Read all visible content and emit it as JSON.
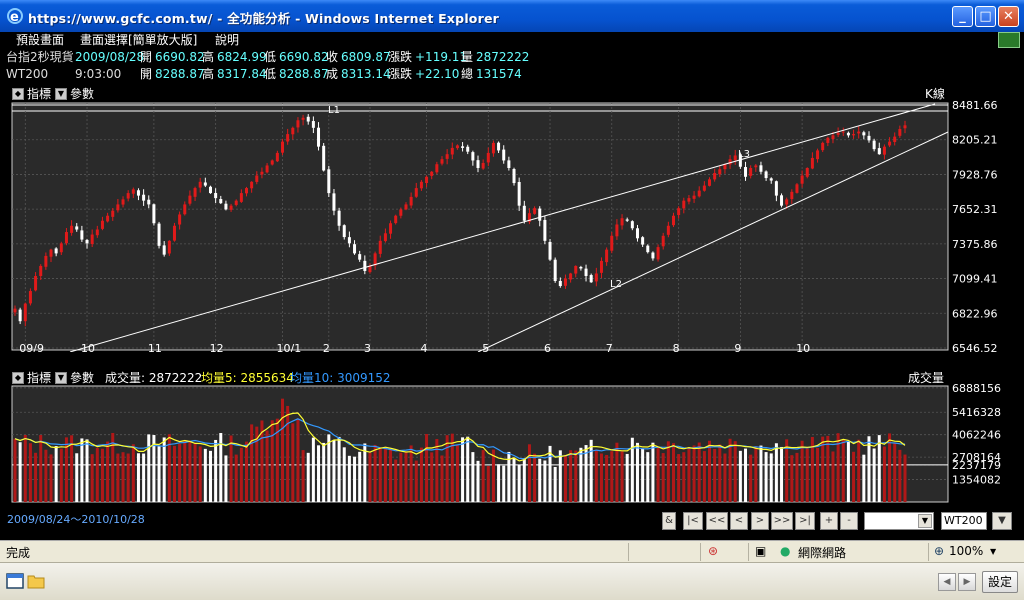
{
  "window": {
    "title": "https://www.gcfc.com.tw/ - 全功能分析 - Windows Internet Explorer",
    "min_label": "_",
    "max_label": "□",
    "close_label": "✕"
  },
  "menu": {
    "items": [
      "預設畫面",
      "畫面選擇[簡單放大版]",
      "說明"
    ]
  },
  "quote_rows": [
    {
      "name": "台指2秒現貨",
      "date": "2009/08/28",
      "open_label": "開",
      "open": "6690.82",
      "high_label": "高",
      "high": "6824.99",
      "low_label": "低",
      "low": "6690.82",
      "close_label": "收",
      "close": "6809.87",
      "chg_label": "漲跌",
      "chg": "+119.11",
      "vol_label": "量",
      "vol": "2872222"
    },
    {
      "name": "WT200",
      "date": "9:03:00",
      "open_label": "開",
      "open": "8288.87",
      "high_label": "高",
      "high": "8317.84",
      "low_label": "低",
      "low": "8288.87",
      "close_label": "成",
      "close": "8313.14",
      "chg_label": "漲跌",
      "chg": "+22.10",
      "vol_label": "總",
      "vol": "131574"
    }
  ],
  "price_panel": {
    "indicator_label": "指標",
    "param_label": "參數",
    "type_label": "K線",
    "trend_labels": [
      "L1",
      "L2",
      "L3"
    ]
  },
  "volume_panel": {
    "indicator_label": "指標",
    "param_label": "參數",
    "vol_text": "成交量: 2872222",
    "ma5_text": "均量5: 2855634",
    "ma10_text": "均量10: 3009152",
    "type_label": "成交量"
  },
  "navbar": {
    "daterange": "2009/08/24～2010/10/28",
    "buttons": [
      "&",
      "|<",
      "<<",
      "<",
      ">",
      ">>",
      ">|",
      "+",
      "-"
    ],
    "symbol_value": "WT200"
  },
  "statusbar": {
    "status_text": "完成",
    "zone_text": "網際網路",
    "zoom_text": "100%"
  },
  "taskbar": {
    "settings_label": "設定"
  },
  "colors": {
    "up": "#e11a1a",
    "down": "#ffffff",
    "ma5": "#ffff33",
    "ma10": "#3399ff",
    "trendline": "#ffffff",
    "accent_cyan": "#66ffff"
  },
  "chart_data": [
    {
      "type": "candlestick",
      "title": "",
      "yticks": [
        8481.66,
        8205.21,
        7928.76,
        7652.31,
        7375.86,
        7099.41,
        6822.96,
        6546.52
      ],
      "ylim": [
        6546.52,
        8481.66
      ],
      "xticks": [
        "09/9",
        "10",
        "11",
        "12",
        "10/1",
        "2",
        "3",
        "4",
        "5",
        "6",
        "7",
        "8",
        "9",
        "10"
      ],
      "close_series": [
        6860,
        6760,
        6900,
        7000,
        7120,
        7200,
        7280,
        7330,
        7300,
        7380,
        7470,
        7520,
        7490,
        7410,
        7380,
        7450,
        7490,
        7560,
        7600,
        7640,
        7690,
        7730,
        7780,
        7810,
        7760,
        7720,
        7690,
        7540,
        7360,
        7290,
        7400,
        7520,
        7610,
        7690,
        7760,
        7820,
        7870,
        7840,
        7780,
        7740,
        7700,
        7650,
        7680,
        7720,
        7780,
        7820,
        7870,
        7920,
        7950,
        8000,
        8040,
        8100,
        8190,
        8250,
        8300,
        8360,
        8380,
        8350,
        8300,
        8150,
        7960,
        7780,
        7640,
        7520,
        7430,
        7380,
        7300,
        7250,
        7160,
        7200,
        7300,
        7400,
        7460,
        7540,
        7600,
        7650,
        7690,
        7750,
        7820,
        7870,
        7910,
        7950,
        8010,
        8050,
        8090,
        8140,
        8160,
        8140,
        8110,
        8040,
        7980,
        8020,
        8100,
        8180,
        8120,
        8040,
        7980,
        7860,
        7680,
        7560,
        7620,
        7660,
        7560,
        7400,
        7250,
        7080,
        7040,
        7100,
        7140,
        7200,
        7180,
        7120,
        7070,
        7140,
        7240,
        7330,
        7440,
        7530,
        7580,
        7560,
        7500,
        7420,
        7370,
        7310,
        7260,
        7350,
        7440,
        7520,
        7600,
        7660,
        7720,
        7740,
        7760,
        7800,
        7840,
        7890,
        7940,
        7970,
        8010,
        8050,
        8080,
        7990,
        7910,
        7980,
        8000,
        7950,
        7900,
        7880,
        7760,
        7680,
        7730,
        7790,
        7850,
        7920,
        7980,
        8060,
        8120,
        8180,
        8220,
        8240,
        8260,
        8270,
        8240,
        8250,
        8270,
        8240,
        8200,
        8130,
        8090,
        8150,
        8190,
        8230,
        8290,
        8320
      ],
      "trendlines": [
        {
          "name": "L1",
          "points": [
            [
              "09/9",
              6520
            ],
            [
              "end",
              8481
            ]
          ]
        },
        {
          "name": "L2",
          "points": [
            [
              "4",
              6550
            ],
            [
              "end",
              8290
            ]
          ]
        },
        {
          "name": "L3",
          "points": [
            [
              "09/9",
              8470
            ],
            [
              "end",
              8470
            ]
          ]
        }
      ]
    },
    {
      "type": "bar",
      "title": "",
      "yticks": [
        6888156,
        5416328,
        4062246,
        2708164,
        2237179,
        1354082
      ],
      "series": [
        {
          "name": "成交量",
          "values": [
            2708164,
            2237179,
            3009152,
            2872222
          ]
        },
        {
          "name": "均量5",
          "values": [
            2855634
          ]
        },
        {
          "name": "均量10",
          "values": [
            3009152
          ]
        }
      ]
    }
  ]
}
